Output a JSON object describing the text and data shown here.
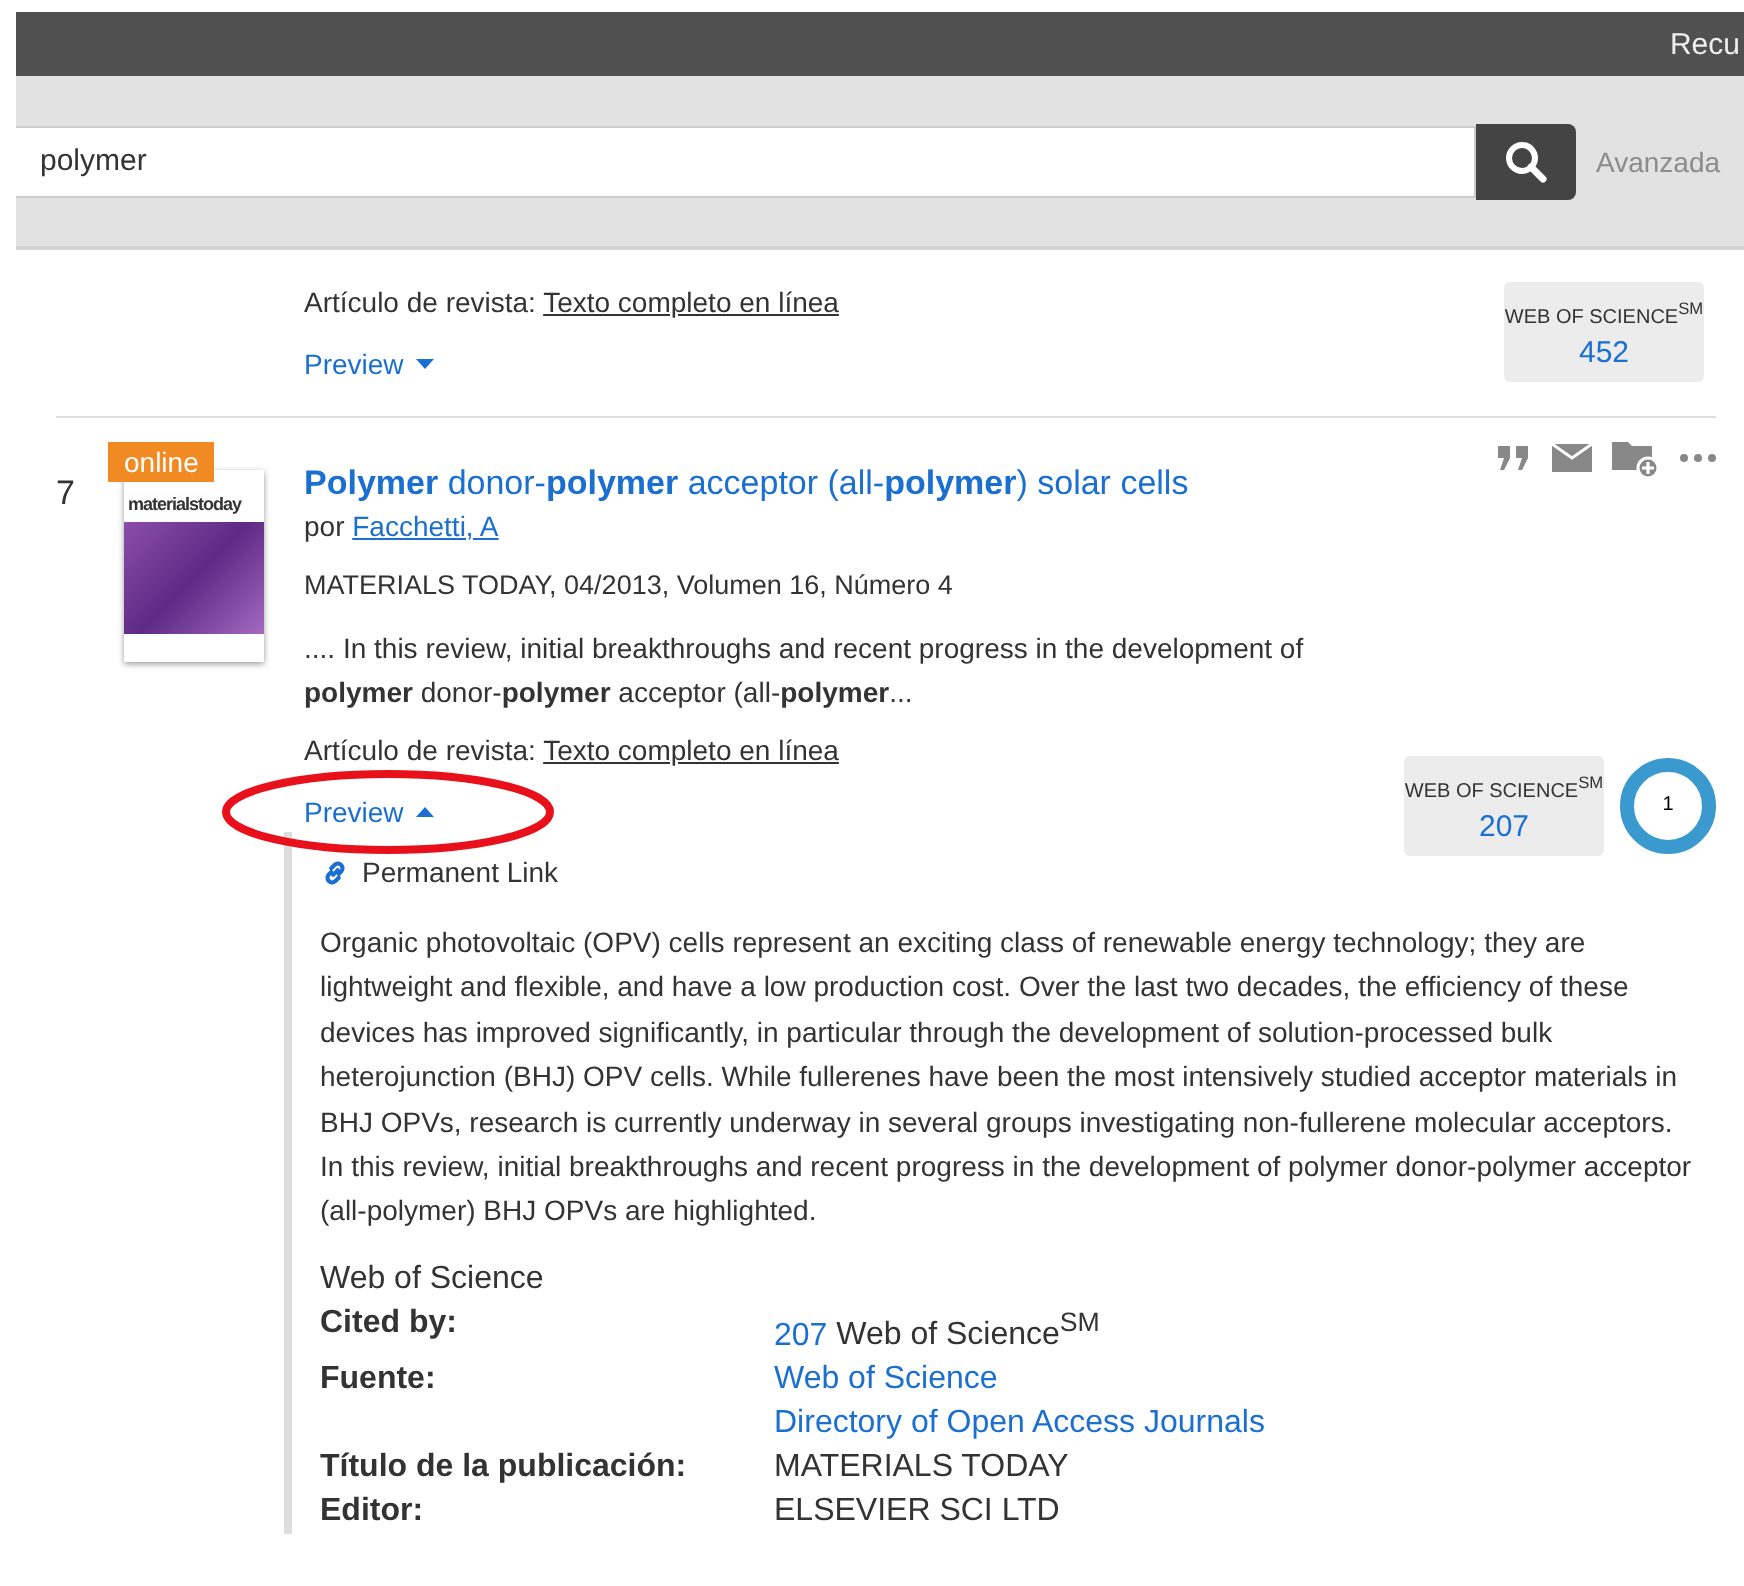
{
  "header": {
    "link": "Recu"
  },
  "search": {
    "value": "polymer",
    "advanced_link": "Avanzada"
  },
  "results": [
    {
      "type_label": "Artículo de revista:",
      "fulltext_link": "Texto completo en línea",
      "preview": {
        "label": "Preview",
        "expanded": false
      },
      "metric": {
        "label": "WEB OF SCIENCE$^{SM}$",
        "count": "452"
      }
    },
    {
      "number": "7",
      "badge": "online",
      "cover_text": "materialstoday",
      "title": "**Polymer** donor-**polymer** acceptor (all-**polymer**) solar cells",
      "author_prefix": "por",
      "author": "Facchetti, A",
      "source": "MATERIALS TODAY, 04/2013, Volumen 16, Número 4",
      "snippet": ".... In this review, initial breakthroughs and recent progress in the development of **polymer** donor-**polymer** acceptor (all-**polymer**...",
      "type_label": "Artículo de revista:",
      "fulltext_link": "Texto completo en línea",
      "preview": {
        "label": "Preview",
        "expanded": true,
        "circled": true
      },
      "metric": {
        "label": "WEB OF SCIENCE$^{SM}$",
        "count": "207"
      },
      "altmetric": "1",
      "details": {
        "permanent_link": "Permanent Link",
        "abstract": "Organic photovoltaic (OPV) cells represent an exciting class of renewable energy technology; they are lightweight and flexible, and have a low production cost. Over the last two decades, the efficiency of these devices has improved significantly, in particular through the development of solution-processed bulk heterojunction (BHJ) OPV cells. While fullerenes have been the most intensively studied acceptor materials in BHJ OPVs, research is currently underway in several groups investigating non-fullerene molecular acceptors. In this review, initial breakthroughs and recent progress in the development of polymer donor-polymer acceptor (all-polymer) BHJ OPVs are highlighted.",
        "section_title": "Web of Science",
        "fields": [
          {
            "label": "Cited by:",
            "values": [
              [
                {
                  "kind": "link",
                  "text": "207"
                },
                {
                  "kind": "text",
                  "text": "Web of Science$^{SM}$"
                }
              ]
            ]
          },
          {
            "label": "Fuente:",
            "values": [
              [
                {
                  "kind": "link",
                  "text": "Web of Science"
                }
              ],
              [
                {
                  "kind": "link",
                  "text": "Directory of Open Access Journals"
                }
              ]
            ]
          },
          {
            "label": "Título de la publicación:",
            "values": [
              [
                {
                  "kind": "text",
                  "text": "MATERIALS TODAY"
                }
              ]
            ]
          },
          {
            "label": "Editor:",
            "values": [
              [
                {
                  "kind": "text",
                  "text": "ELSEVIER SCI LTD"
                }
              ]
            ]
          }
        ]
      }
    }
  ]
}
